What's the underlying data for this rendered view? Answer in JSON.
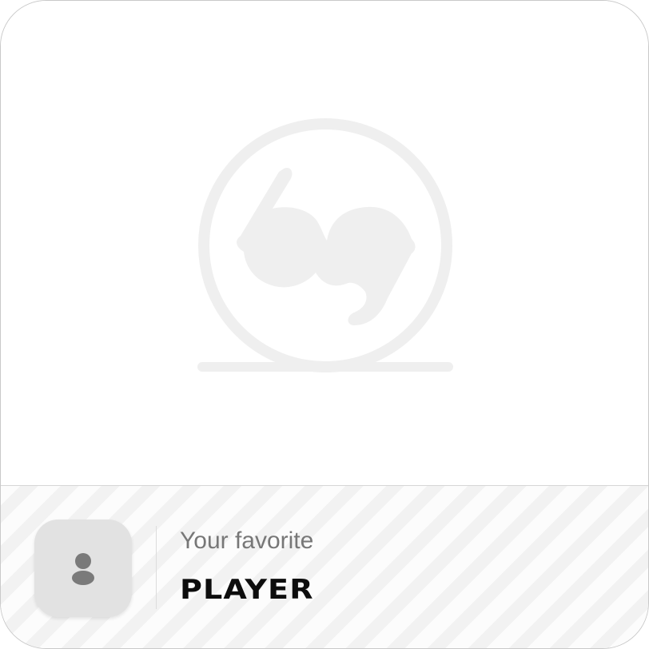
{
  "card": {
    "hero_icon": "whistle-logo-placeholder-icon",
    "subtitle": "Your favorite",
    "title": "PLAYER",
    "avatar_icon": "user-icon"
  },
  "colors": {
    "placeholder_icon": "#efefef",
    "avatar_bg": "#e2e2e2",
    "avatar_icon": "#7a7a7a",
    "title": "#0d0d0d",
    "subtitle": "#777777"
  }
}
